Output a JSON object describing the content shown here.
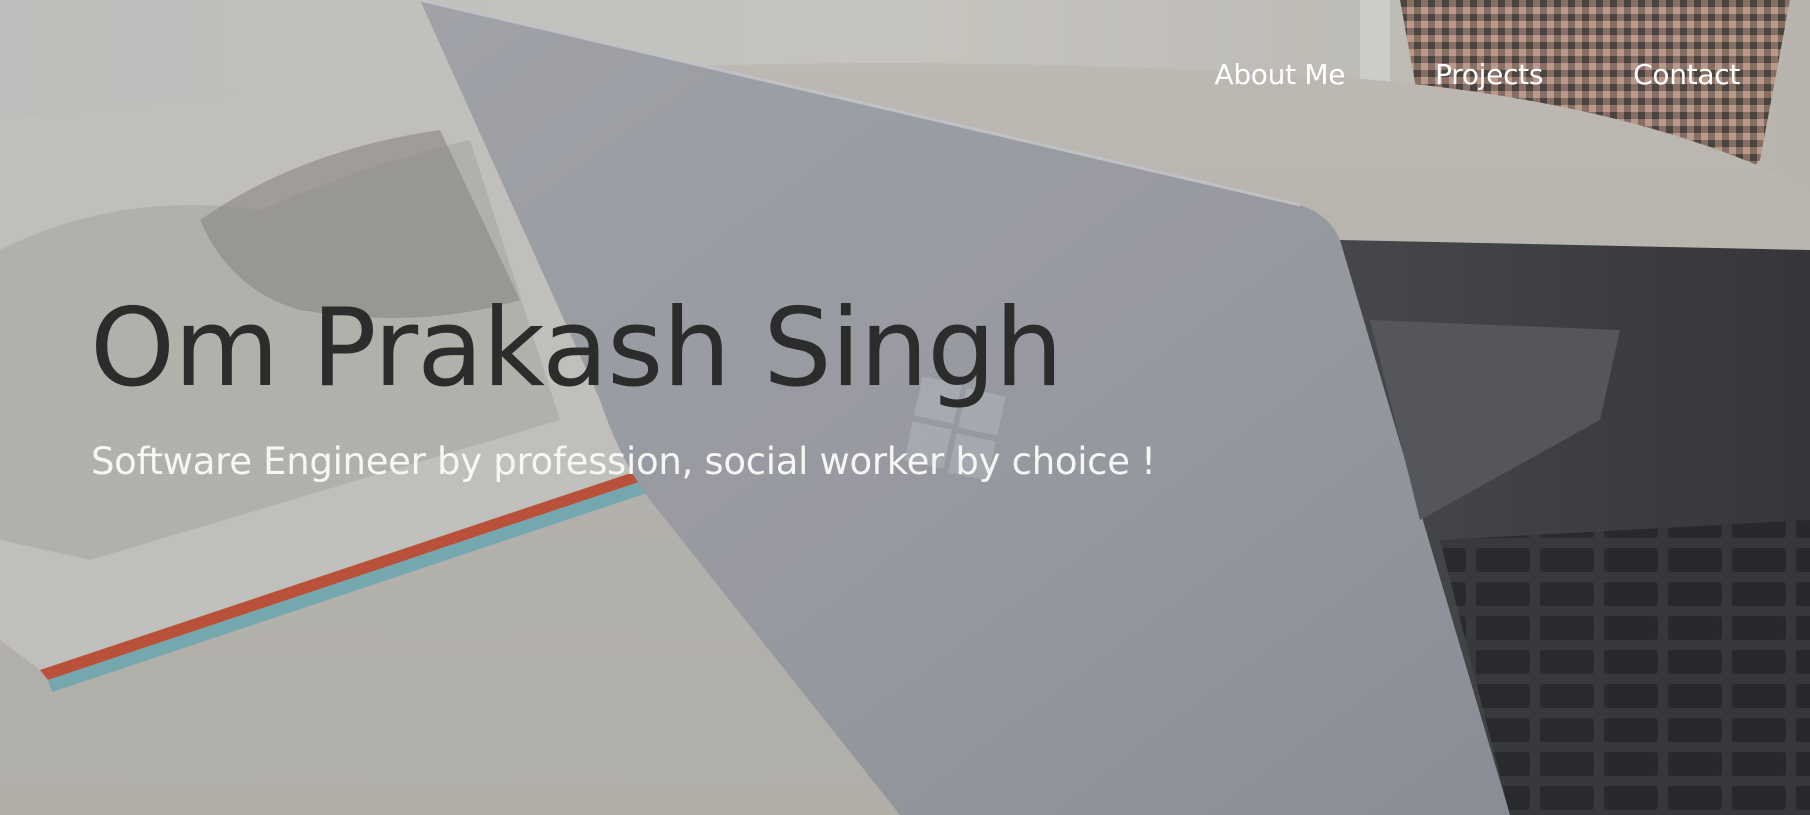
{
  "nav": {
    "items": [
      {
        "label": "About Me"
      },
      {
        "label": "Projects"
      },
      {
        "label": "Contact"
      }
    ]
  },
  "hero": {
    "name": "Om Prakash Singh",
    "tagline": "Software Engineer by profession, social worker by choice !",
    "background": {
      "subject": "laptop-and-sketchbook-photo",
      "overlay_color": "#000000",
      "overlay_opacity": 0.08
    }
  },
  "colors": {
    "title": "#2c2c2c",
    "nav_text": "#ffffff",
    "tagline": "#f6f6f4"
  }
}
